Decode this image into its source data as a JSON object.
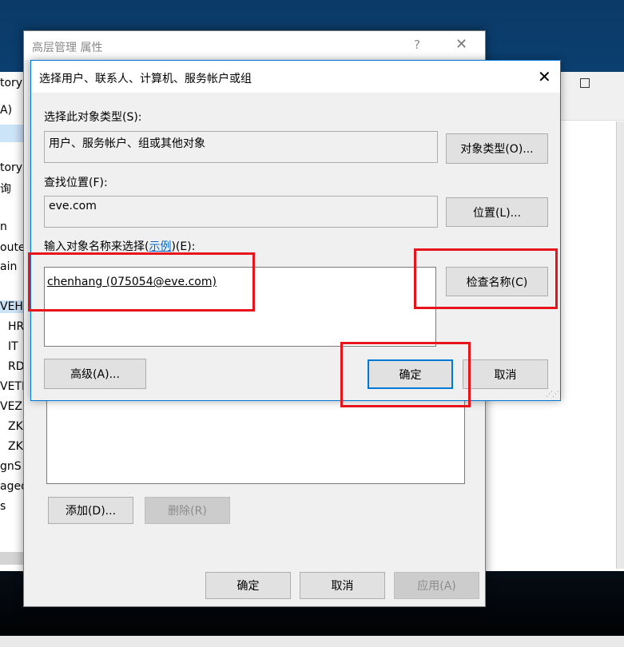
{
  "background_window": {
    "lines": [
      "tory",
      "A)",
      "tory",
      "询",
      "n",
      "oute",
      "ain",
      "VEHT",
      "HR",
      "IT",
      "RD",
      "VETH",
      "VEZK",
      "ZK",
      "ZK",
      "gnS",
      "aged",
      "s"
    ]
  },
  "properties_dialog": {
    "title": "高层管理 属性",
    "help_glyph": "?",
    "close_glyph": "✕",
    "add_button": "添加(D)...",
    "remove_button": "删除(R)",
    "ok_button": "确定",
    "cancel_button": "取消",
    "apply_button": "应用(A)"
  },
  "select_dialog": {
    "title": "选择用户、联系人、计算机、服务帐户或组",
    "close_glyph": "✕",
    "object_type_label": "选择此对象类型(S):",
    "object_type_value": "用户、服务帐户、组或其他对象",
    "object_types_button": "对象类型(O)...",
    "location_label": "查找位置(F):",
    "location_value": "eve.com",
    "locations_button": "位置(L)...",
    "names_label_prefix": "输入对象名称来选择(",
    "names_label_link": "示例",
    "names_label_suffix": ")(E):",
    "names_value": "chenhang (075054@eve.com)",
    "check_names_button": "检查名称(C)",
    "advanced_button": "高级(A)...",
    "ok_button": "确定",
    "cancel_button": "取消"
  },
  "colors": {
    "accent": "#0078d7",
    "highlight": "#e8141b"
  }
}
